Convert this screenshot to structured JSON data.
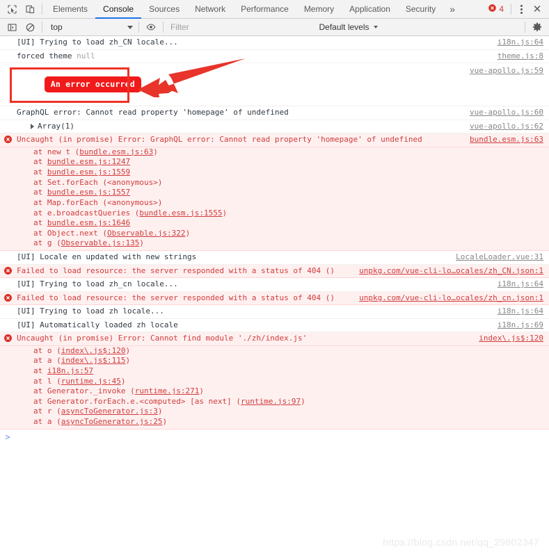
{
  "topbar": {
    "icons": [
      {
        "name": "inspect-element-icon",
        "title": "Inspect element"
      },
      {
        "name": "device-toolbar-icon",
        "title": "Toggle device toolbar"
      }
    ],
    "tabs": [
      {
        "label": "Elements",
        "active": false
      },
      {
        "label": "Console",
        "active": true
      },
      {
        "label": "Sources",
        "active": false
      },
      {
        "label": "Network",
        "active": false
      },
      {
        "label": "Performance",
        "active": false
      },
      {
        "label": "Memory",
        "active": false
      },
      {
        "label": "Application",
        "active": false
      },
      {
        "label": "Security",
        "active": false
      }
    ],
    "more_tabs_label": "»",
    "error_count": "4",
    "close_label": "✕"
  },
  "filterbar": {
    "execution_context": "top",
    "filter_placeholder": "Filter",
    "levels_label": "Default levels",
    "eye_icon_title": "Create live expression",
    "clear_icon_title": "Clear console",
    "sidebar_icon_title": "Show console sidebar",
    "settings_icon_title": "Console settings"
  },
  "console": {
    "rows": [
      {
        "kind": "log",
        "message": "[UI] Trying to load zh_CN locale...",
        "source": "i18n.js:64"
      },
      {
        "kind": "log",
        "message": "forced theme ",
        "dim_suffix": "null",
        "source": "theme.js:8"
      },
      {
        "kind": "pill",
        "message": "An error occurred",
        "source": "vue-apollo.js:59"
      },
      {
        "kind": "log",
        "message": "GraphQL error: Cannot read property 'homepage' of undefined",
        "source": "vue-apollo.js:60"
      },
      {
        "kind": "object",
        "message": "Array(1)",
        "source": "vue-apollo.js:62"
      },
      {
        "kind": "error",
        "message": "Uncaught (in promise) Error: GraphQL error: Cannot read property 'homepage' of undefined",
        "source": "bundle.esm.js:63",
        "stack": [
          {
            "prefix": "at new t (",
            "link": "bundle.esm.js:63",
            "suffix": ")"
          },
          {
            "prefix": "at ",
            "link": "bundle.esm.js:1247",
            "suffix": ""
          },
          {
            "prefix": "at ",
            "link": "bundle.esm.js:1559",
            "suffix": ""
          },
          {
            "prefix": "at Set.forEach (<anonymous>)",
            "link": "",
            "suffix": ""
          },
          {
            "prefix": "at ",
            "link": "bundle.esm.js:1557",
            "suffix": ""
          },
          {
            "prefix": "at Map.forEach (<anonymous>)",
            "link": "",
            "suffix": ""
          },
          {
            "prefix": "at e.broadcastQueries (",
            "link": "bundle.esm.js:1555",
            "suffix": ")"
          },
          {
            "prefix": "at ",
            "link": "bundle.esm.js:1646",
            "suffix": ""
          },
          {
            "prefix": "at Object.next (",
            "link": "Observable.js:322",
            "suffix": ")"
          },
          {
            "prefix": "at g (",
            "link": "Observable.js:135",
            "suffix": ")"
          }
        ]
      },
      {
        "kind": "log",
        "message": "[UI] Locale en updated with new strings",
        "source": "LocaleLoader.vue:31"
      },
      {
        "kind": "error",
        "message": "Failed to load resource: the server responded with a status of 404 ()",
        "source": "unpkg.com/vue-cli-lo…ocales/zh_CN.json:1"
      },
      {
        "kind": "log",
        "message": "[UI] Trying to load zh_cn locale...",
        "source": "i18n.js:64"
      },
      {
        "kind": "error",
        "message": "Failed to load resource: the server responded with a status of 404 ()",
        "source": "unpkg.com/vue-cli-lo…ocales/zh_cn.json:1"
      },
      {
        "kind": "log",
        "message": "[UI] Trying to load zh locale...",
        "source": "i18n.js:64"
      },
      {
        "kind": "log",
        "message": "[UI] Automatically loaded zh locale",
        "source": "i18n.js:69"
      },
      {
        "kind": "error",
        "message": "Uncaught (in promise) Error: Cannot find module './zh/index.js'",
        "source": "index\\.js$:120",
        "stack": [
          {
            "prefix": "at o (",
            "link": "index\\.js$:120",
            "suffix": ")"
          },
          {
            "prefix": "at a (",
            "link": "index\\.js$:115",
            "suffix": ")"
          },
          {
            "prefix": "at ",
            "link": "i18n.js:57",
            "suffix": ""
          },
          {
            "prefix": "at l (",
            "link": "runtime.js:45",
            "suffix": ")"
          },
          {
            "prefix": "at Generator._invoke (",
            "link": "runtime.js:271",
            "suffix": ")"
          },
          {
            "prefix": "at Generator.forEach.e.<computed> [as next] (",
            "link": "runtime.js:97",
            "suffix": ")"
          },
          {
            "prefix": "at r (",
            "link": "asyncToGenerator.js:3",
            "suffix": ")"
          },
          {
            "prefix": "at a (",
            "link": "asyncToGenerator.js:25",
            "suffix": ")"
          }
        ]
      }
    ],
    "prompt_caret": ">"
  },
  "annotation": {
    "box_color": "#ee3124",
    "arrow_color": "#e8342a"
  },
  "watermark": "https://blog.csdn.net/qq_29602347"
}
